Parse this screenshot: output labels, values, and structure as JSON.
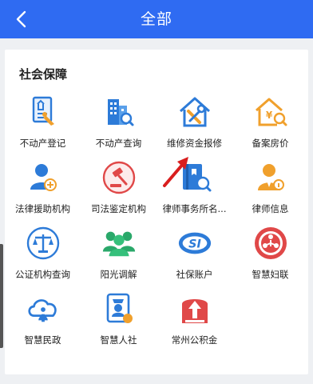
{
  "header": {
    "title": "全部",
    "back_icon": "chevron-left-icon"
  },
  "section": {
    "title": "社会保障"
  },
  "items": [
    {
      "label": "不动产登记",
      "icon": "property-document-icon"
    },
    {
      "label": "不动产查询",
      "icon": "building-search-icon"
    },
    {
      "label": "维修资金报修",
      "icon": "house-tools-icon"
    },
    {
      "label": "备案房价",
      "icon": "house-price-icon"
    },
    {
      "label": "法律援助机构",
      "icon": "legal-aid-person-icon"
    },
    {
      "label": "司法鉴定机构",
      "icon": "gavel-icon"
    },
    {
      "label": "律师事务所名...",
      "icon": "law-book-search-icon"
    },
    {
      "label": "律师信息",
      "icon": "lawyer-info-icon"
    },
    {
      "label": "公证机构查询",
      "icon": "scales-icon"
    },
    {
      "label": "阳光调解",
      "icon": "group-mediation-icon"
    },
    {
      "label": "社保账户",
      "icon": "social-insurance-icon"
    },
    {
      "label": "智慧妇联",
      "icon": "womens-federation-icon"
    },
    {
      "label": "智慧民政",
      "icon": "cloud-civil-affairs-icon"
    },
    {
      "label": "智慧人社",
      "icon": "people-badge-icon"
    },
    {
      "label": "常州公积金",
      "icon": "housing-fund-icon"
    }
  ],
  "colors": {
    "header": "#2f6bf2",
    "icon_blue": "#2d7bd8",
    "icon_orange": "#f0a02c",
    "icon_red": "#e04848",
    "icon_green": "#2aa86a",
    "annotation_arrow": "#d91e1e"
  }
}
